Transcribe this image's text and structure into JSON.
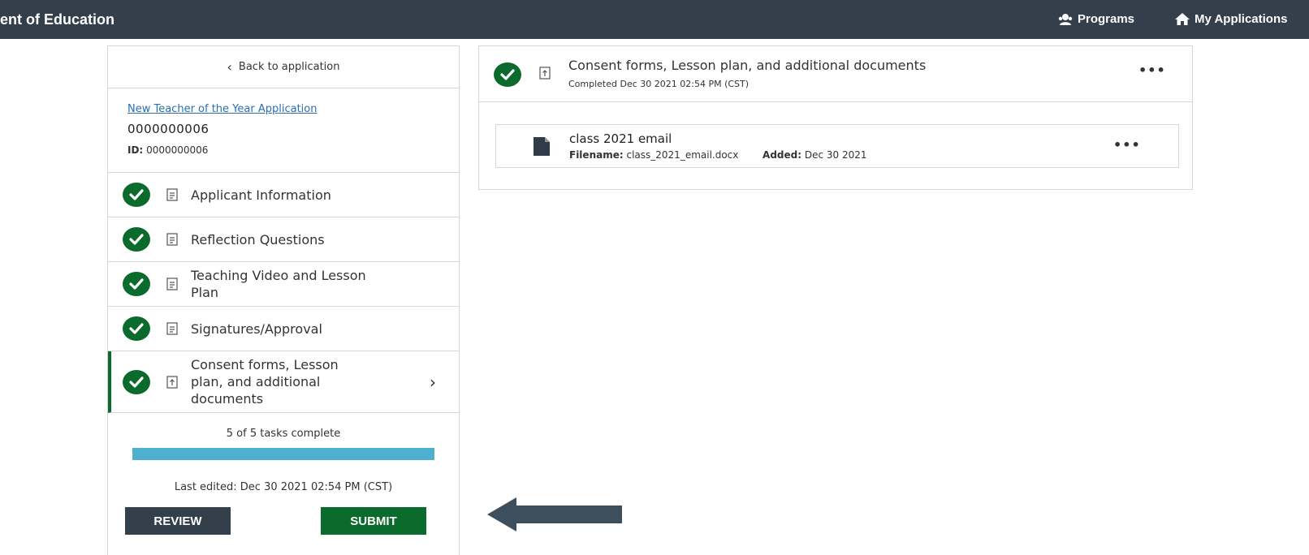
{
  "topbar": {
    "brand": "ent of Education",
    "nav": {
      "programs": "Programs",
      "my_applications": "My Applications"
    }
  },
  "sidebar": {
    "back_label": "Back to application",
    "application": {
      "link": "New Teacher of the Year Application",
      "number": "0000000006",
      "id_label": "ID:",
      "id_value": "0000000006"
    },
    "tasks": [
      {
        "label": "Applicant Information",
        "icon": "document-icon",
        "status": "complete"
      },
      {
        "label": "Reflection Questions",
        "icon": "document-icon",
        "status": "complete"
      },
      {
        "label": "Teaching Video and Lesson Plan",
        "icon": "document-icon",
        "status": "complete"
      },
      {
        "label": "Signatures/Approval",
        "icon": "document-icon",
        "status": "complete"
      },
      {
        "label": "Consent forms, Lesson plan, and additional documents",
        "icon": "upload-icon",
        "status": "complete",
        "active": true
      }
    ],
    "progress": {
      "text": "5 of 5 tasks complete",
      "fraction": 1.0
    },
    "last_edited": "Last edited: Dec 30 2021 02:54 PM (CST)",
    "buttons": {
      "review": "REVIEW",
      "submit": "SUBMIT"
    }
  },
  "main": {
    "header": {
      "title": "Consent forms, Lesson plan, and additional documents",
      "subtitle": "Completed Dec 30 2021 02:54 PM (CST)"
    },
    "file": {
      "title": "class 2021 email",
      "filename_label": "Filename:",
      "filename": "class_2021_email.docx",
      "added_label": "Added:",
      "added": "Dec 30 2021"
    }
  },
  "colors": {
    "topbar": "#333f4b",
    "check": "#0a6b2c",
    "submit": "#0a6b2c",
    "review": "#333f4b",
    "progress_fill": "#4eafd0",
    "link": "#2a6fb0",
    "arrow": "#3d4f5c"
  }
}
